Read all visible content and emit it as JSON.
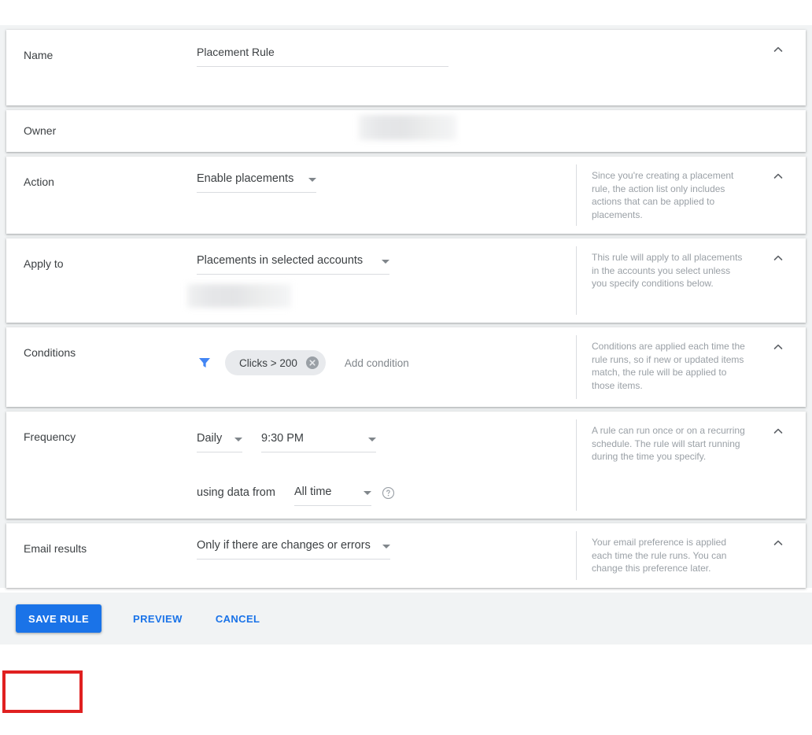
{
  "sections": {
    "name": {
      "label": "Name",
      "value": "Placement Rule"
    },
    "owner": {
      "label": "Owner",
      "value_redacted": ""
    },
    "action": {
      "label": "Action",
      "value": "Enable placements",
      "help": "Since you're creating a placement rule, the action list only includes actions that can be applied to placements."
    },
    "apply_to": {
      "label": "Apply to",
      "value": "Placements in selected accounts",
      "account_redacted": "",
      "help": "This rule will apply to all placements in the accounts you select unless you specify conditions below."
    },
    "conditions": {
      "label": "Conditions",
      "chips": [
        {
          "label": "Clicks > 200"
        }
      ],
      "add_label": "Add condition",
      "help": "Conditions are applied each time the rule runs, so if new or updated items match, the rule will be applied to those items."
    },
    "frequency": {
      "label": "Frequency",
      "interval": "Daily",
      "time": "9:30 PM",
      "using_data_from_label": "using data from",
      "data_range": "All time",
      "help": "A rule can run once or on a recurring schedule. The rule will start running during the time you specify."
    },
    "email_results": {
      "label": "Email results",
      "value": "Only if there are changes or errors",
      "help": "Your email preference is applied each time the rule runs. You can change this preference later."
    }
  },
  "footer": {
    "save_label": "SAVE RULE",
    "preview_label": "PREVIEW",
    "cancel_label": "CANCEL"
  },
  "colors": {
    "accent_blue": "#1a73e8",
    "filter_blue": "#4285f4",
    "highlight_red": "#e02020",
    "chip_bg": "#e8eaed",
    "card_bg_surround": "#f1f3f4",
    "help_text": "#9aa0a6",
    "primary_text": "#3c4043"
  },
  "icons": {
    "collapse": "chevron-up-icon",
    "filter": "filter-icon",
    "chip_remove": "close-circle-icon",
    "help": "help-circle-icon",
    "dropdown": "chevron-down-icon"
  }
}
